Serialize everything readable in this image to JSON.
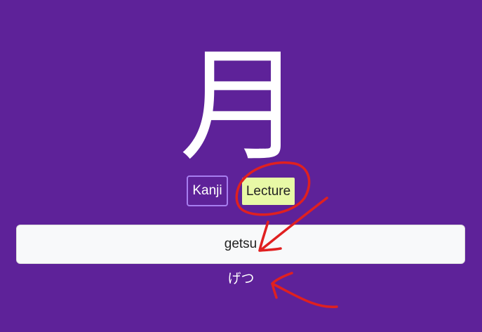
{
  "card": {
    "character": "月",
    "reading": "げつ"
  },
  "buttons": {
    "kanji_label": "Kanji",
    "lecture_label": "Lecture"
  },
  "answer": {
    "value": "getsu"
  },
  "colors": {
    "background": "#5e2299",
    "lecture_highlight": "#e8f9a6",
    "kanji_border": "#a77ef0",
    "annotation": "#e02020"
  }
}
